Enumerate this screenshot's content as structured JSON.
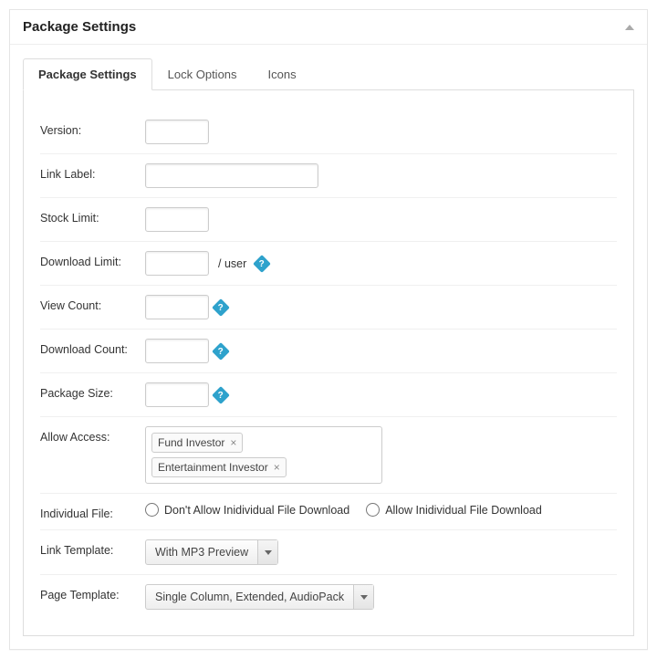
{
  "header": {
    "title": "Package Settings"
  },
  "tabs": [
    {
      "label": "Package Settings",
      "active": true
    },
    {
      "label": "Lock Options"
    },
    {
      "label": "Icons"
    }
  ],
  "fields": {
    "version": {
      "label": "Version:",
      "value": ""
    },
    "linkLabel": {
      "label": "Link Label:",
      "value": ""
    },
    "stockLimit": {
      "label": "Stock Limit:",
      "value": ""
    },
    "downloadLimit": {
      "label": "Download Limit:",
      "value": "",
      "suffix": "/ user"
    },
    "viewCount": {
      "label": "View Count:",
      "value": ""
    },
    "downloadCount": {
      "label": "Download Count:",
      "value": ""
    },
    "packageSize": {
      "label": "Package Size:",
      "value": ""
    },
    "allowAccess": {
      "label": "Allow Access:",
      "tags": [
        "Fund Investor",
        "Entertainment Investor"
      ]
    },
    "individualFile": {
      "label": "Individual File:",
      "options": [
        "Don't Allow Inidividual File Download",
        "Allow Inidividual File Download"
      ]
    },
    "linkTemplate": {
      "label": "Link Template:",
      "selected": "With MP3 Preview"
    },
    "pageTemplate": {
      "label": "Page Template:",
      "selected": "Single Column, Extended, AudioPack"
    }
  },
  "helpGlyph": "?"
}
